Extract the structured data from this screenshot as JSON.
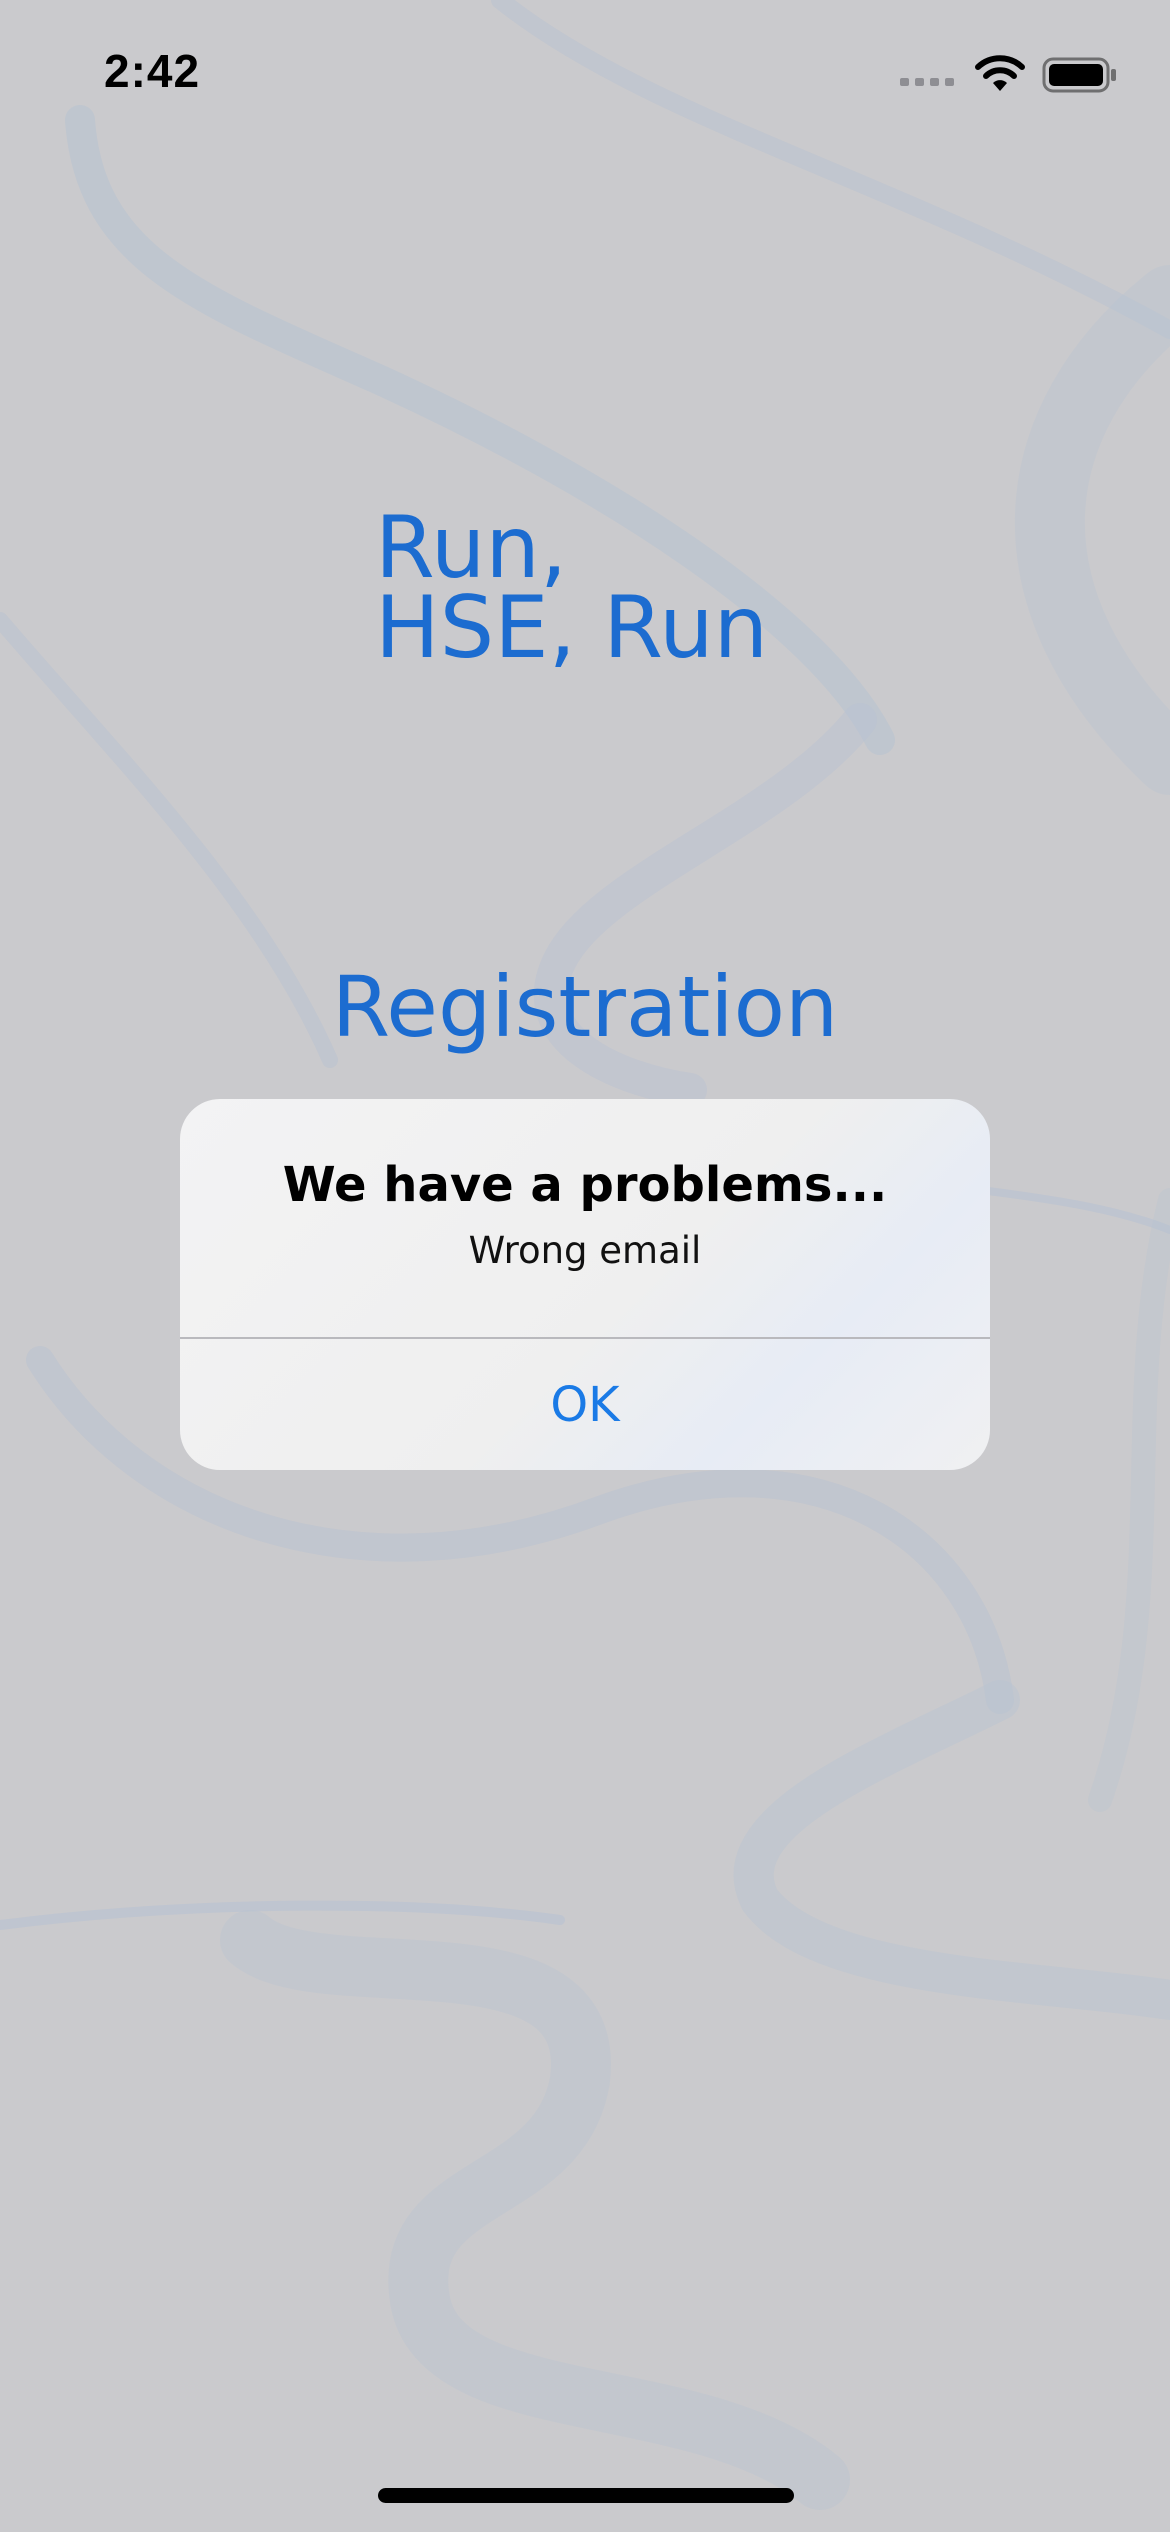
{
  "status_bar": {
    "time": "2:42",
    "icons": [
      "cellular-signal-icon",
      "wifi-icon",
      "battery-icon"
    ]
  },
  "app": {
    "title_line1": "Run,",
    "title_line2": "HSE, Run",
    "heading": "Registration"
  },
  "alert": {
    "title": "We have a problems...",
    "message": "Wrong email",
    "ok_label": "OK"
  },
  "colors": {
    "accent": "#1c6cd0",
    "button": "#1a7ae6",
    "background": "#cacacd"
  }
}
